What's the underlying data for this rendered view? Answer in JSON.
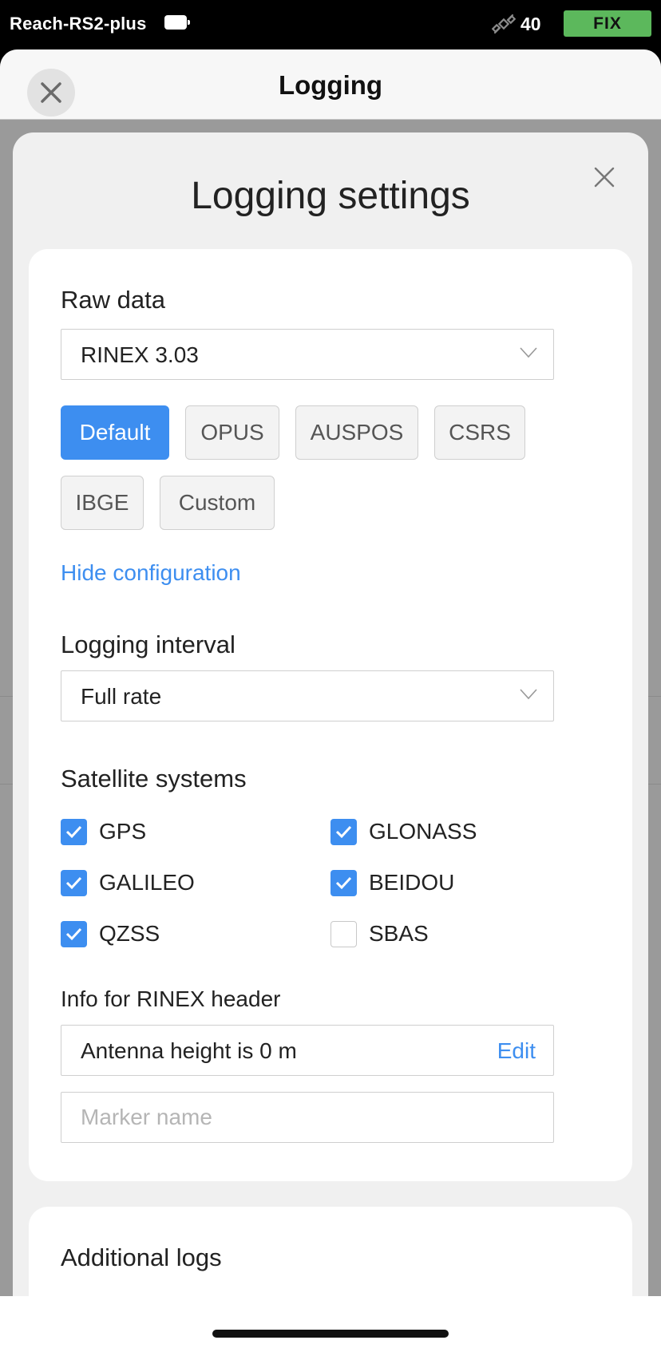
{
  "status_bar": {
    "device_name": "Reach-RS2-plus",
    "satellite_count": "40",
    "fix_status": "FIX",
    "battery_icon": "battery-icon",
    "satellite_icon": "satellite-icon"
  },
  "navbar": {
    "title": "Logging",
    "close_icon": "close-icon"
  },
  "modal": {
    "title": "Logging settings",
    "close_icon": "close-icon"
  },
  "raw_data": {
    "title": "Raw data",
    "format_select": {
      "value": "RINEX 3.03"
    },
    "presets": [
      {
        "label": "Default",
        "active": true
      },
      {
        "label": "OPUS",
        "active": false
      },
      {
        "label": "AUSPOS",
        "active": false
      },
      {
        "label": "CSRS",
        "active": false
      },
      {
        "label": "IBGE",
        "active": false
      },
      {
        "label": "Custom",
        "active": false
      }
    ],
    "hide_config_link": "Hide configuration"
  },
  "logging_interval": {
    "title": "Logging interval",
    "select": {
      "value": "Full rate"
    }
  },
  "satellite_systems": {
    "title": "Satellite systems",
    "items": [
      {
        "label": "GPS",
        "checked": true
      },
      {
        "label": "GLONASS",
        "checked": true
      },
      {
        "label": "GALILEO",
        "checked": true
      },
      {
        "label": "BEIDOU",
        "checked": true
      },
      {
        "label": "QZSS",
        "checked": true
      },
      {
        "label": "SBAS",
        "checked": false
      }
    ]
  },
  "rinex_header": {
    "title": "Info for RINEX header",
    "antenna_height": "Antenna height is 0 m",
    "edit_label": "Edit",
    "marker_name": {
      "value": "",
      "placeholder": "Marker name"
    }
  },
  "additional_logs": {
    "title": "Additional logs"
  },
  "colors": {
    "accent": "#3d8ef0",
    "fix_badge": "#5cb85c"
  }
}
